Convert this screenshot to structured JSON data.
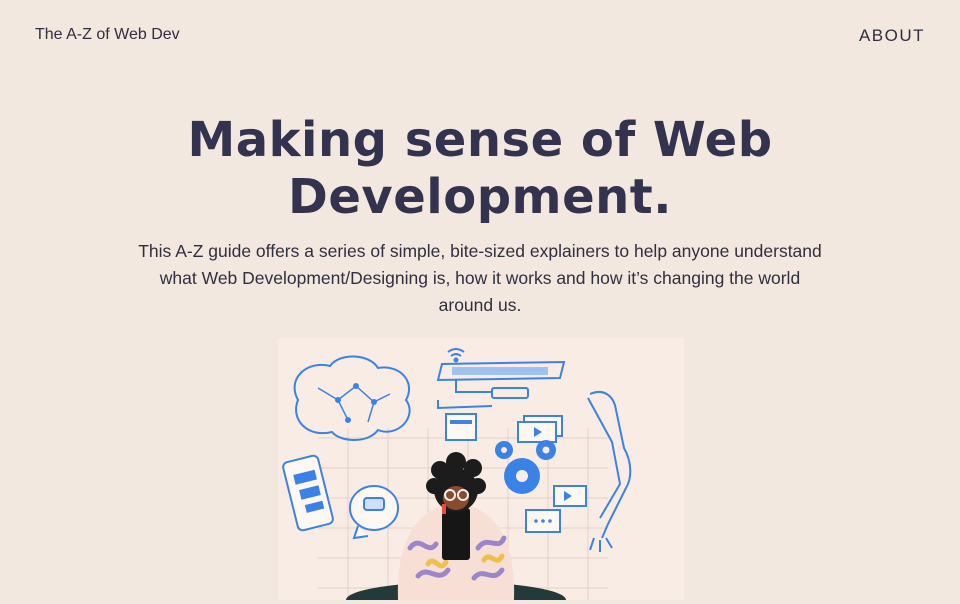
{
  "nav": {
    "brand": "The A-Z of Web Dev",
    "about_link": "ABOUT"
  },
  "hero": {
    "title_line1": "Making sense of Web",
    "title_line2": "Development.",
    "intro": "This A-Z guide offers a series of simple, bite-sized explainers to help anyone understand what Web Development/Designing is, how it works and how it’s changing the world around us."
  },
  "colors": {
    "background": "#f3e8df",
    "title": "#33324f",
    "accent_blue": "#3b82e6",
    "figure_dark": "#1f1f1f"
  }
}
